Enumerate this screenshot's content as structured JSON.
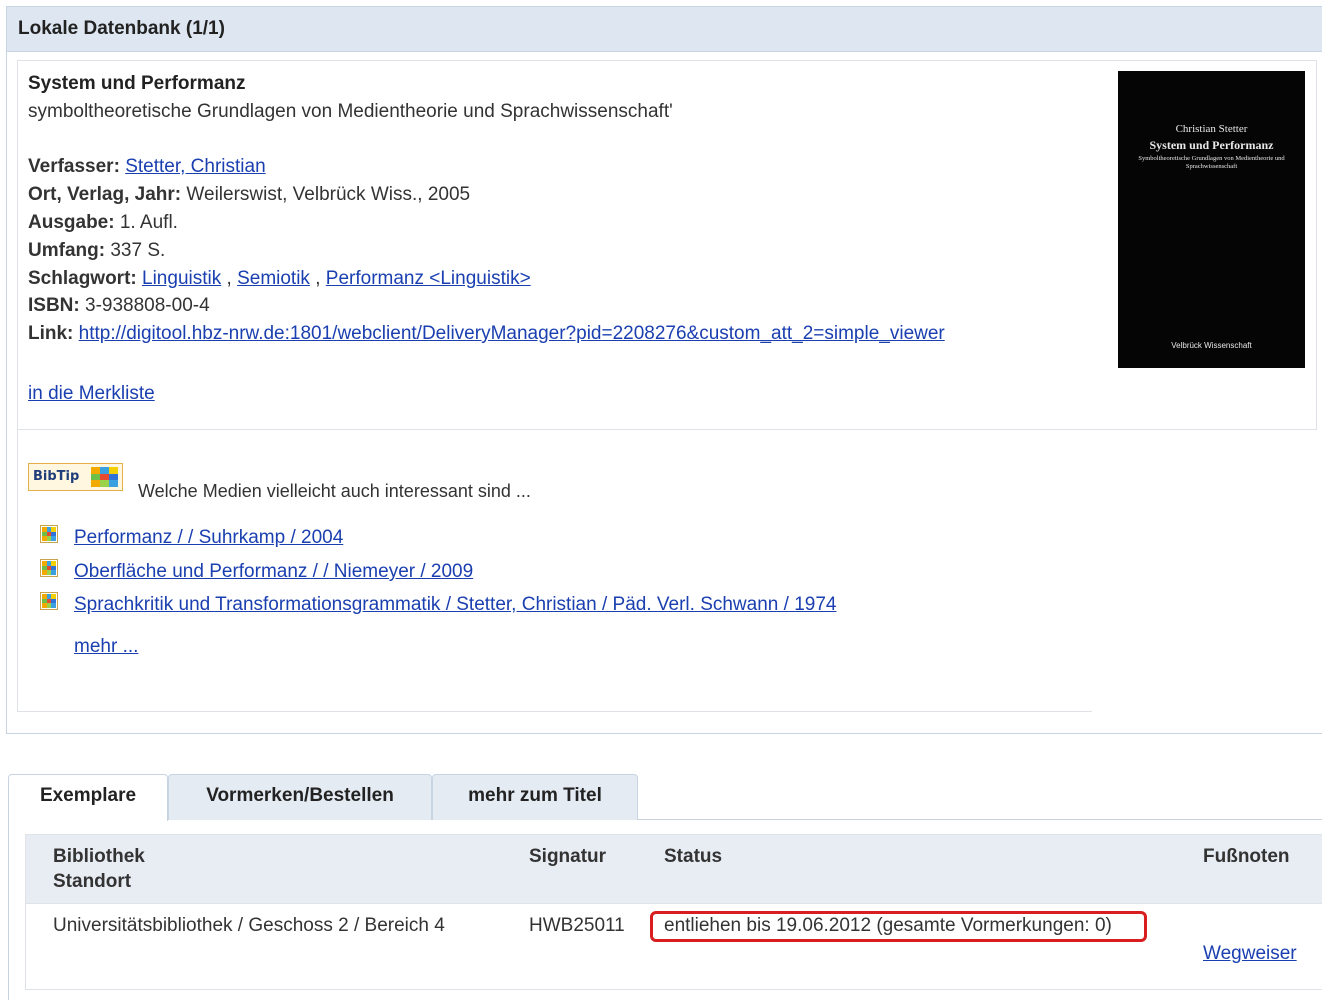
{
  "panel": {
    "title": "Lokale Datenbank (1/1)"
  },
  "record": {
    "title": "System und Performanz",
    "subtitle": "symboltheoretische Grundlagen von Medientheorie und Sprachwissenschaft'",
    "author_label": "Verfasser:",
    "author": "Stetter, Christian",
    "publisher_label": "Ort, Verlag, Jahr:",
    "publisher": "Weilerswist, Velbrück Wiss., 2005",
    "edition_label": "Ausgabe:",
    "edition": "1. Aufl.",
    "extent_label": "Umfang:",
    "extent": "337 S.",
    "subjects_label": "Schlagwort:",
    "subjects": [
      "Linguistik",
      "Semiotik",
      "Performanz <Linguistik>"
    ],
    "separator": ",",
    "isbn_label": "ISBN:",
    "isbn": "3-938808-00-4",
    "link_label": "Link:",
    "link": "http://digitool.hbz-nrw.de:1801/webclient/DeliveryManager?pid=2208276&custom_att_2=simple_viewer",
    "watchlist": "in die Merkliste"
  },
  "cover": {
    "author": "Christian Stetter",
    "title": "System und Performanz",
    "subtitle": "Symboltheoretische Grundlagen von Medientheorie und Sprachwissenschaft",
    "publisher": "Velbrück Wissenschaft"
  },
  "bibtip": {
    "logo": "BibTip",
    "intro": "Welche Medien vielleicht auch interessant sind ...",
    "items": [
      "Performanz / / Suhrkamp / 2004",
      "Oberfläche und Performanz / / Niemeyer / 2009",
      "Sprachkritik und Transformationsgrammatik / Stetter, Christian / Päd. Verl. Schwann / 1974"
    ],
    "more": "mehr ..."
  },
  "tabs": [
    "Exemplare",
    "Vormerken/Bestellen",
    "mehr zum Titel"
  ],
  "holdings": {
    "headers": {
      "library_line1": "Bibliothek",
      "library_line2": "Standort",
      "signature": "Signatur",
      "status": "Status",
      "footnotes": "Fußnoten"
    },
    "rows": [
      {
        "library": "Universitätsbibliothek / Geschoss 2 / Bereich 4",
        "signature": "HWB25011",
        "status": "entliehen bis 19.06.2012 (gesamte Vormerkungen: 0)",
        "footnote_link": "Wegweiser"
      }
    ]
  },
  "colors": {
    "header_bg": "#dde6f1",
    "link": "#1a3fb0",
    "status_highlight": "#d81e1e",
    "bibtip_mosaic": [
      "#f2a900",
      "#3aa0e0",
      "#f5d000",
      "#6cc04a",
      "#e84a2f",
      "#2f72d8",
      "#f2a900",
      "#9ad34a",
      "#3aa0e0"
    ]
  }
}
